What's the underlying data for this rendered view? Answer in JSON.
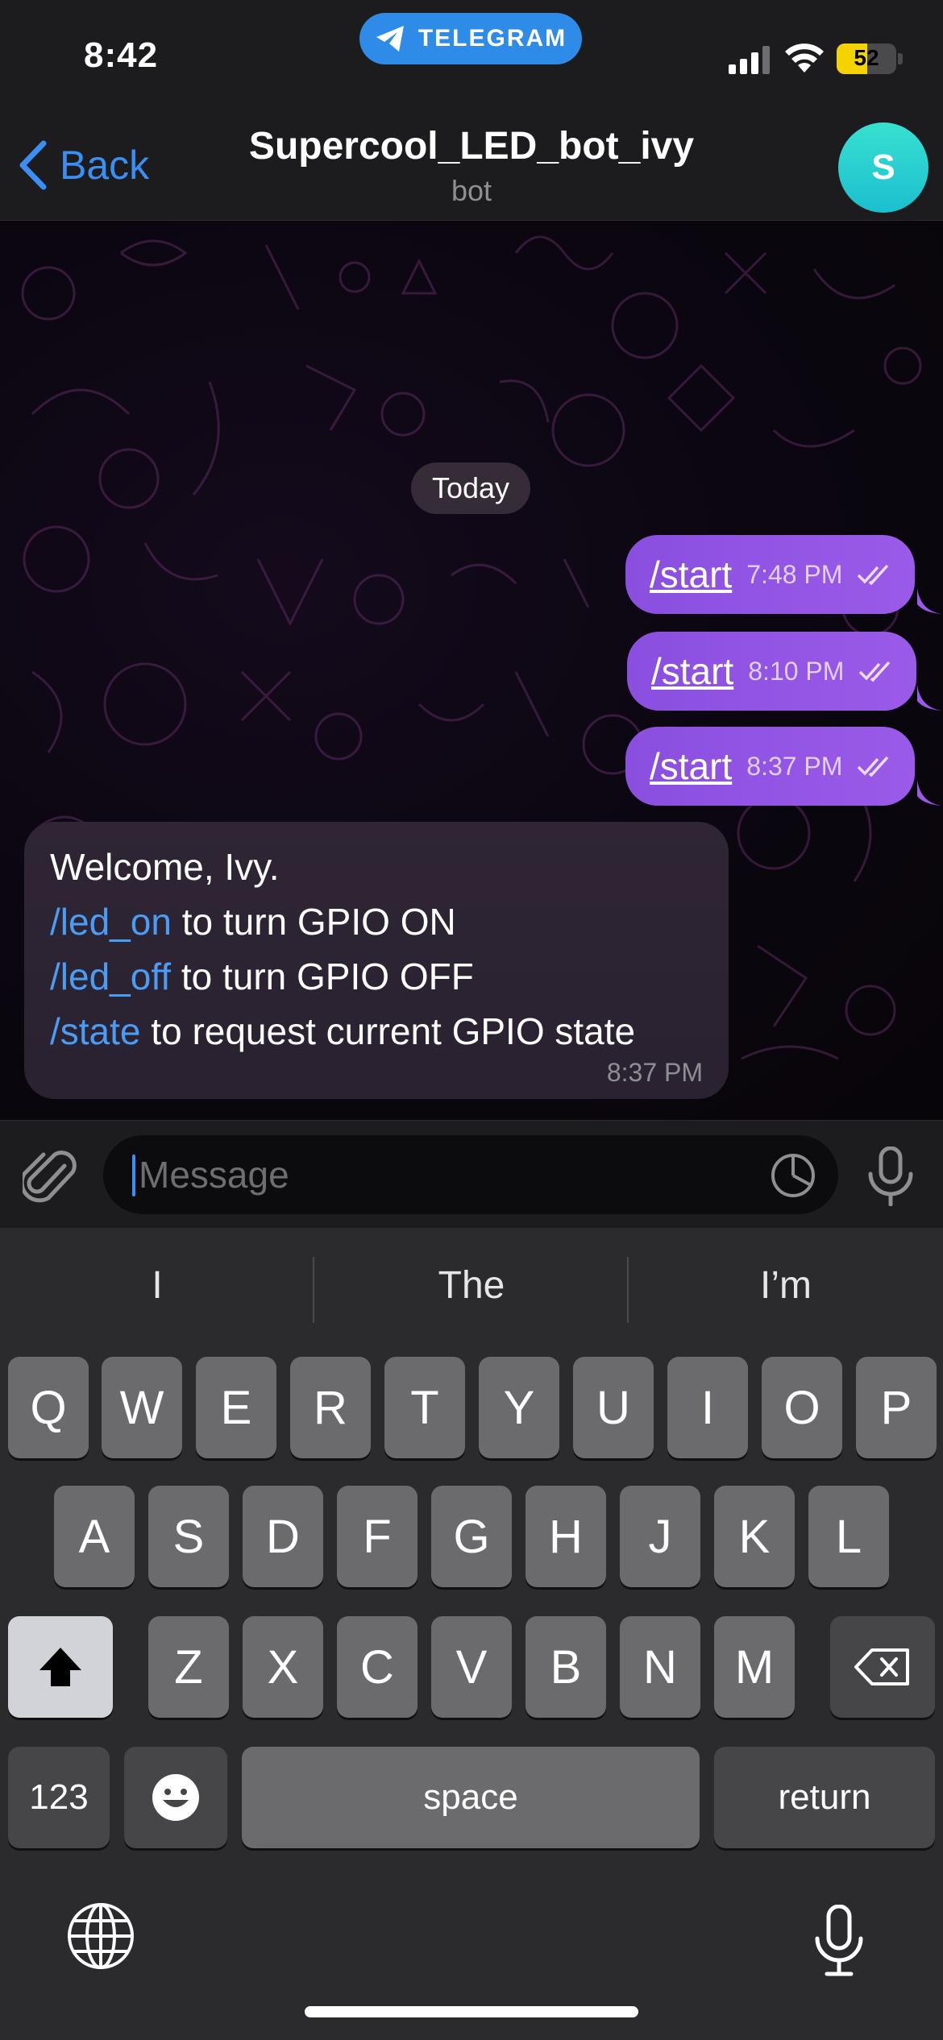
{
  "status_bar": {
    "time": "8:42",
    "app_pill": "TELEGRAM",
    "battery_level": "52"
  },
  "header": {
    "back_label": "Back",
    "title": "Supercool_LED_bot_ivy",
    "subtitle": "bot",
    "avatar_initial": "S"
  },
  "chat": {
    "date_separator": "Today",
    "outgoing": [
      {
        "text": "/start",
        "time": "7:48 PM"
      },
      {
        "text": "/start",
        "time": "8:10 PM"
      },
      {
        "text": "/start",
        "time": "8:37 PM"
      }
    ],
    "incoming": {
      "greeting": "Welcome, Ivy.",
      "commands": [
        {
          "cmd": "/led_on",
          "desc": " to turn GPIO ON"
        },
        {
          "cmd": "/led_off",
          "desc": " to turn GPIO OFF"
        },
        {
          "cmd": "/state",
          "desc": " to request current GPIO state"
        }
      ],
      "time": "8:37 PM"
    }
  },
  "composer": {
    "placeholder": "Message"
  },
  "keyboard": {
    "suggestions": [
      "I",
      "The",
      "I’m"
    ],
    "row1": [
      "Q",
      "W",
      "E",
      "R",
      "T",
      "Y",
      "U",
      "I",
      "O",
      "P"
    ],
    "row2": [
      "A",
      "S",
      "D",
      "F",
      "G",
      "H",
      "J",
      "K",
      "L"
    ],
    "row3": [
      "Z",
      "X",
      "C",
      "V",
      "B",
      "N",
      "M"
    ],
    "numbers_key": "123",
    "space_key": "space",
    "return_key": "return"
  },
  "colors": {
    "accent": "#3a8ff5",
    "outgoing_bubble": "#9455e6",
    "telegram_pill": "#2f8be8",
    "battery": "#f5d300"
  }
}
